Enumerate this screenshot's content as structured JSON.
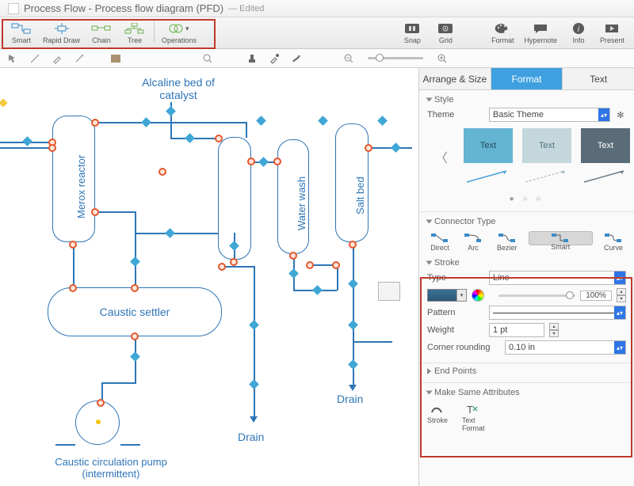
{
  "title": "Process Flow - Process flow diagram (PFD)",
  "edited_suffix": "— Edited",
  "toolbar": {
    "smart": "Smart",
    "rapid": "Rapid Draw",
    "chain": "Chain",
    "tree": "Tree",
    "operations": "Operations",
    "snap": "Snap",
    "grid": "Grid",
    "format": "Format",
    "hypernote": "Hypernote",
    "info": "Info",
    "present": "Present"
  },
  "canvas": {
    "alkaline": "Alcaline bed of\ncatalyst",
    "merox": "Merox reactor",
    "water": "Water wash",
    "salt": "Salt bed",
    "settler": "Caustic settler",
    "pump": "Caustic circulation pump\n(intermittent)",
    "drain": "Drain"
  },
  "panel": {
    "tab_arrange": "Arrange & Size",
    "tab_format": "Format",
    "tab_text": "Text",
    "style": "Style",
    "theme_label": "Theme",
    "theme_value": "Basic Theme",
    "swatch_text": "Text",
    "conn_header": "Connector Type",
    "conn": {
      "direct": "Direct",
      "arc": "Arc",
      "bezier": "Bezier",
      "smart": "Smart",
      "curve": "Curve"
    },
    "stroke_header": "Stroke",
    "type_label": "Type",
    "type_value": "Line",
    "opacity": "100%",
    "pattern_label": "Pattern",
    "weight_label": "Weight",
    "weight_value": "1 pt",
    "corner_label": "Corner rounding",
    "corner_value": "0.10 in",
    "endpoints": "End Points",
    "makesame": "Make Same Attributes",
    "ms_stroke": "Stroke",
    "ms_text": "Text\nFormat"
  }
}
